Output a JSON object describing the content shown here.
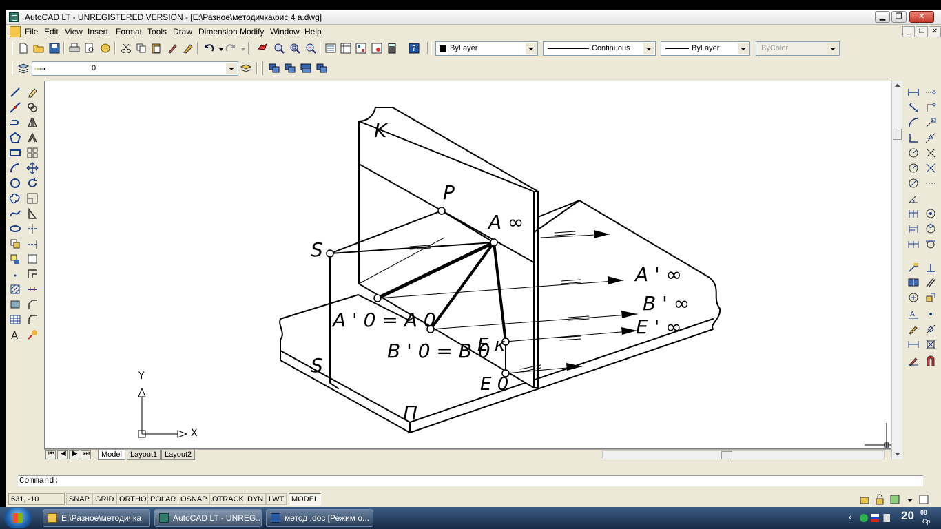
{
  "window": {
    "title": "AutoCAD LT - UNREGISTERED VERSION - [E:\\Разное\\методичка\\рис 4 а.dwg]",
    "minimize": "0",
    "maximize": "1",
    "close": "r"
  },
  "menu": {
    "items": [
      "File",
      "Edit",
      "View",
      "Insert",
      "Format",
      "Tools",
      "Draw",
      "Dimension",
      "Modify",
      "Window",
      "Help"
    ],
    "mdi_controls": [
      "_",
      "❐",
      "✕"
    ]
  },
  "properties": {
    "color": "ByLayer",
    "linetype": "Continuous",
    "lineweight": "ByLayer",
    "plotstyle": "ByColor"
  },
  "layers": {
    "current_layer": "0"
  },
  "drawing": {
    "labels": {
      "k": "K",
      "p": "P",
      "a_inf": "A ∞",
      "s_top": "S",
      "s_bottom": "S",
      "a1_inf": "A ' ∞",
      "b1_inf": "B ' ∞",
      "e1_inf": "E ' ∞",
      "a0": "A ' 0 = A 0",
      "b0": "B ' 0 = B 0",
      "ek": "E к",
      "e0": "E 0",
      "pi": "П"
    },
    "ucs": {
      "x": "X",
      "y": "Y"
    }
  },
  "tabs": [
    "Model",
    "Layout1",
    "Layout2"
  ],
  "command": {
    "prompt": "Command:"
  },
  "status": {
    "coords": "631, -10",
    "buttons": [
      "SNAP",
      "GRID",
      "ORTHO",
      "POLAR",
      "OSNAP",
      "OTRACK",
      "DYN",
      "LWT",
      "MODEL"
    ]
  },
  "taskbar": {
    "items": [
      {
        "label": "E:\\Разное\\методичка",
        "icon": "folder-icon"
      },
      {
        "label": "AutoCAD LT - UNREG...",
        "icon": "autocad-icon"
      },
      {
        "label": "метод .doc [Режим о...",
        "icon": "word-icon"
      }
    ],
    "clock_time": "20",
    "clock_minutes": "08",
    "clock_day": "Ср"
  }
}
